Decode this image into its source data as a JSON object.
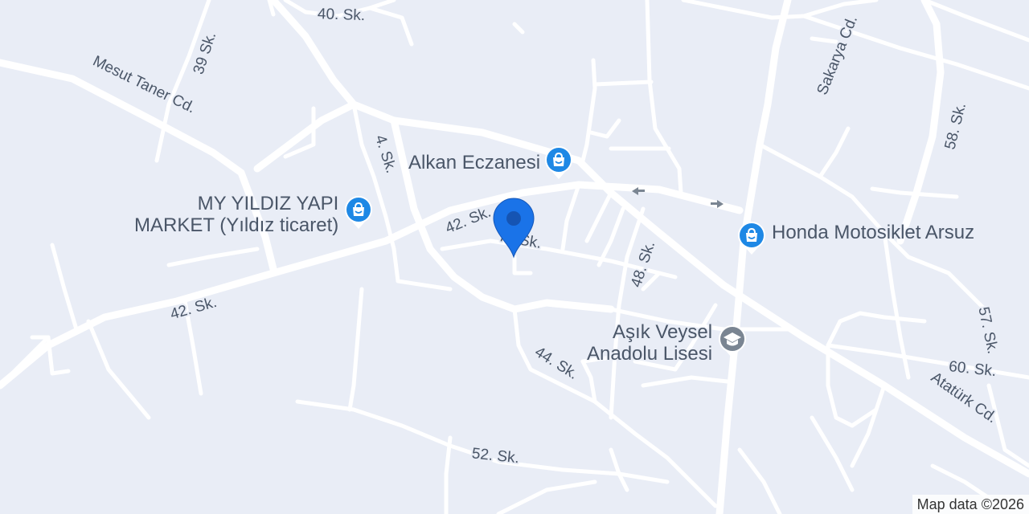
{
  "map": {
    "attribution": "Map data ©2026",
    "accent_color": "#1a73e8",
    "poi_color": "#1e88e5",
    "school_color": "#7a8592",
    "streets": [
      "40. Sk.",
      "39 Sk.",
      "Mesut Taner Cd.",
      "4. Sk.",
      "42. Sk.",
      "42. Sk.",
      "7 . Sk.",
      "48. Sk.",
      "44. Sk.",
      "52. Sk.",
      "Sakarya Cd.",
      "58. Sk.",
      "57. Sk.",
      "60. Sk.",
      "Atatürk Cd."
    ],
    "pois": [
      {
        "name": "Alkan Eczanesi",
        "icon": "shopping-bag-icon"
      },
      {
        "name_line1": "MY YILDIZ YAPI",
        "name_line2": "MARKET (Yıldız ticaret)",
        "icon": "shopping-bag-icon"
      },
      {
        "name": "Honda Motosiklet Arsuz",
        "icon": "shopping-bag-icon"
      },
      {
        "name_line1": "Aşık Veysel",
        "name_line2": "Anadolu Lisesi",
        "icon": "school-icon"
      }
    ],
    "marker": {
      "icon": "location-pin-icon"
    }
  }
}
